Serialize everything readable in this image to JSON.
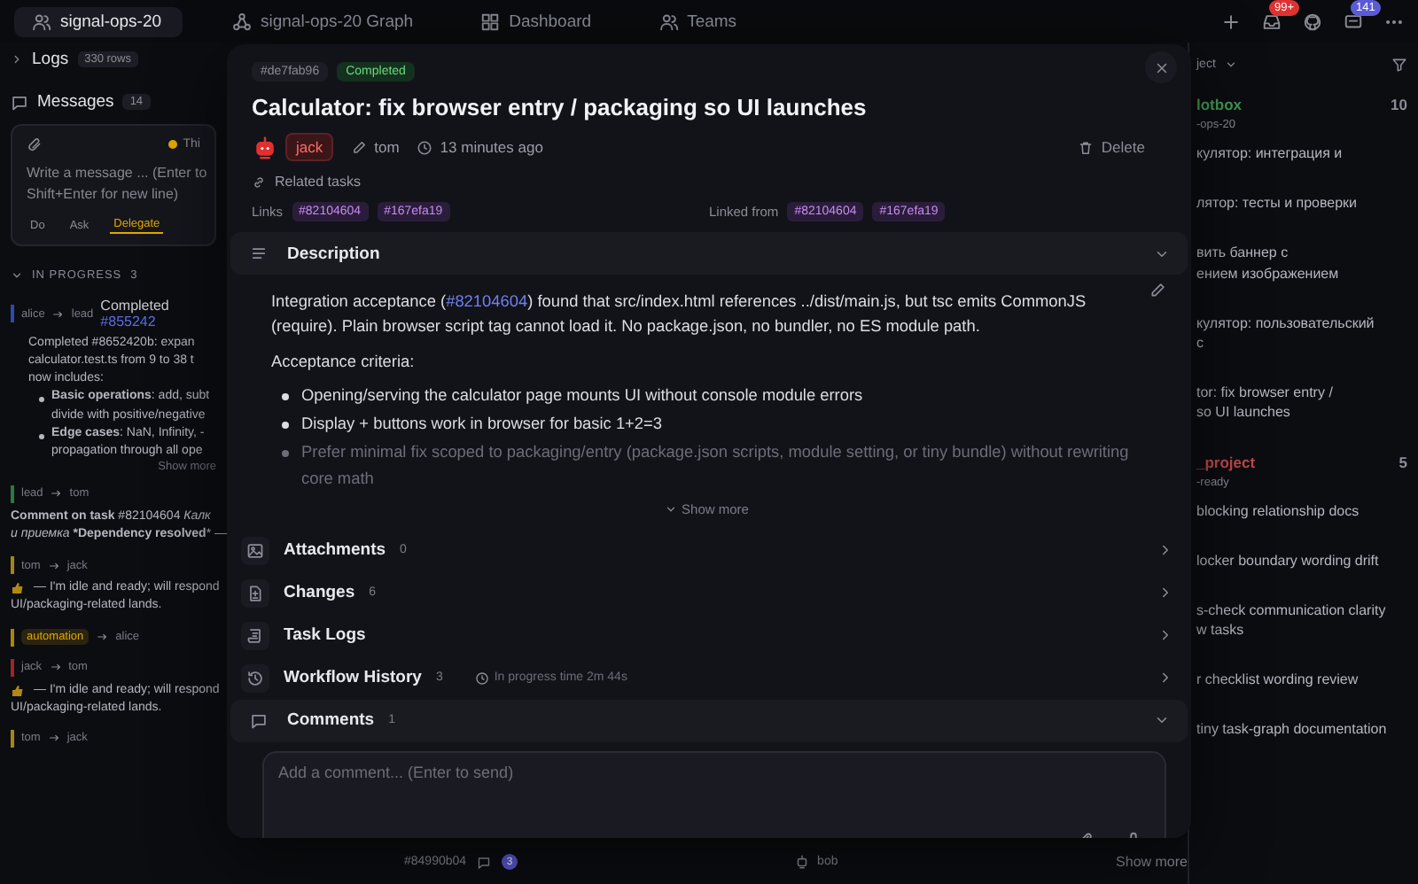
{
  "top_tabs": [
    {
      "label": "signal-ops-20",
      "selected": true
    },
    {
      "label": "signal-ops-20 Graph",
      "selected": false
    },
    {
      "label": "Dashboard",
      "selected": false
    },
    {
      "label": "Teams",
      "selected": false
    }
  ],
  "top_badges": {
    "notifications": "99+",
    "messages": "141"
  },
  "left_panel": {
    "logs": {
      "label": "Logs",
      "count": "330 rows"
    },
    "messages": {
      "label": "Messages",
      "count": "14"
    },
    "composer": {
      "status": "Thi",
      "placeholder": "Write a message ... (Enter to Shift+Enter for new line)",
      "modes": [
        {
          "label": "Do",
          "selected": false
        },
        {
          "label": "Ask",
          "selected": false
        },
        {
          "label": "Delegate",
          "selected": true
        }
      ]
    },
    "section": {
      "label": "IN PROGRESS",
      "count": "3"
    },
    "entries": [
      {
        "from": "alice",
        "to": "lead",
        "color": "#3049a8",
        "title": "Completed",
        "title_link": "#855242",
        "lines": [
          "Completed #8652420b: expan",
          "calculator.test.ts from 9 to 38 t",
          "now includes:"
        ],
        "bullets": [
          [
            "**Basic operations**: add, subt",
            "divide with positive/negative"
          ],
          [
            "**Edge cases**: NaN, Infinity, -",
            "propagation through all ope"
          ]
        ],
        "show_more": "Show more"
      },
      {
        "from": "lead",
        "to": "tom",
        "color": "#2b7a3c",
        "lines": [
          "**Comment on task** #82104604 *Калк*",
          "*и приемка* ***Dependency resolved*** —"
        ]
      },
      {
        "from": "tom",
        "to": "jack",
        "color": "#a8860c",
        "thumbs": true,
        "lines": [
          "— I'm idle and ready; will respond",
          "UI/packaging-related lands."
        ]
      },
      {
        "tag": "automation",
        "to": "alice",
        "color": "#a8860c"
      },
      {
        "from": "jack",
        "to": "tom",
        "color": "#9c2626",
        "thumbs": true,
        "lines": [
          "— I'm idle and ready; will respond",
          "UI/packaging-related lands."
        ]
      },
      {
        "from": "tom",
        "to": "jack",
        "color": "#a8860c"
      }
    ]
  },
  "bottom_row": {
    "task": "#84990b04",
    "count": "3",
    "assignee": "bob",
    "show_more": "Show more"
  },
  "right_panel": {
    "header": "ject",
    "groups": [
      {
        "name": "lotbox",
        "count": "10",
        "color": "#3f9a52",
        "sub": "-ops-20",
        "items": [
          [
            "кулятор: интеграция и"
          ],
          [
            "лятор: тесты и проверки"
          ],
          [
            "вить баннер с",
            "ением изображением"
          ],
          [
            "кулятор: пользовательский",
            "с"
          ],
          [
            "tor: fix browser entry /",
            "so UI launches"
          ]
        ]
      },
      {
        "name": "_project",
        "count": "5",
        "color": "#c04848",
        "sub": "-ready",
        "items": [
          [
            "blocking relationship docs"
          ],
          [
            "locker boundary wording drift"
          ],
          [
            "s-check communication clarity",
            "w tasks"
          ],
          [
            "r checklist wording review"
          ],
          [
            "tiny task-graph documentation"
          ]
        ]
      }
    ]
  },
  "modal": {
    "id": "#de7fab96",
    "status": "Completed",
    "title": "Calculator: fix browser entry / packaging so UI launches",
    "assignee": "jack",
    "author": "tom",
    "time": "13 minutes ago",
    "delete": "Delete",
    "related": {
      "label": "Related tasks",
      "links_label": "Links",
      "links": [
        "#82104604",
        "#167efa19"
      ],
      "linked_from_label": "Linked from",
      "linked_from": [
        "#82104604",
        "#167efa19"
      ]
    },
    "sections": [
      {
        "kind": "description",
        "label": "Description",
        "expanded": true
      },
      {
        "kind": "attachments",
        "label": "Attachments",
        "count": "0",
        "expanded": false
      },
      {
        "kind": "changes",
        "label": "Changes",
        "count": "6",
        "expanded": false
      },
      {
        "kind": "logs",
        "label": "Task Logs",
        "expanded": false
      },
      {
        "kind": "history",
        "label": "Workflow History",
        "count": "3",
        "note": "In progress time 2m 44s",
        "expanded": false
      },
      {
        "kind": "comments",
        "label": "Comments",
        "count": "1",
        "expanded": true
      }
    ],
    "description": {
      "before": "Integration acceptance (",
      "link": "#82104604",
      "after": ") found that src/index.html references ../dist/main.js, but tsc emits CommonJS (require). Plain browser script tag cannot load it. No package.json, no bundler, no ES module path.",
      "criteria_label": "Acceptance criteria:",
      "criteria": [
        "Opening/serving the calculator page mounts UI without console module errors",
        "Display + buttons work in browser for basic 1+2=3",
        "Prefer minimal fix scoped to packaging/entry (package.json scripts, module setting, or tiny bundle) without rewriting core math"
      ],
      "show_more": "Show more"
    },
    "comment_field": {
      "placeholder": "Add a comment... (Enter to send)"
    }
  }
}
